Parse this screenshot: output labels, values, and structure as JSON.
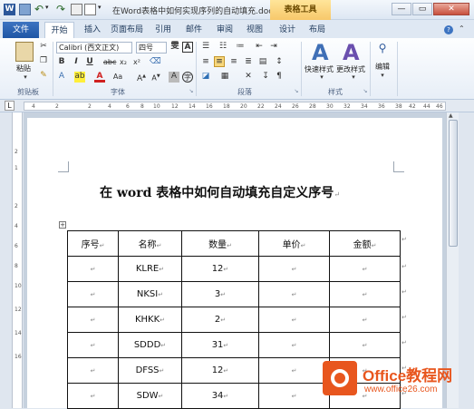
{
  "titlebar": {
    "app_icon": "W",
    "title": "在Word表格中如何实现序列的自动填充.docx M...",
    "table_tools": "表格工具",
    "minimize": "—",
    "maximize": "▭",
    "close": "✕"
  },
  "tabs": [
    "文件",
    "开始",
    "插入",
    "页面布局",
    "引用",
    "邮件",
    "审阅",
    "视图",
    "设计",
    "布局"
  ],
  "ribbon": {
    "paste_label": "粘贴",
    "font_name": "Calibri (西文正文)",
    "font_size": "四号",
    "style_quick": "快速样式",
    "style_change": "更改样式",
    "edit": "编辑",
    "groups": {
      "clipboard": "剪贴板",
      "font": "字体",
      "paragraph": "段落",
      "styles": "样式"
    }
  },
  "ruler": {
    "numbers": [
      "4",
      "2",
      "2",
      "4",
      "6",
      "8",
      "10",
      "12",
      "14",
      "16",
      "18",
      "20",
      "22",
      "24",
      "26",
      "28",
      "30",
      "32",
      "34",
      "36",
      "38",
      "42",
      "44",
      "46"
    ]
  },
  "vruler": {
    "numbers": [
      "2",
      "1",
      "2",
      "4",
      "6",
      "8",
      "10",
      "12",
      "14",
      "16"
    ]
  },
  "document": {
    "heading": "在 word 表格中如何自动填充自定义序号",
    "paragraph_mark": "↵",
    "table": {
      "headers": [
        "序号",
        "名称",
        "数量",
        "单价",
        "金额"
      ],
      "rows": [
        [
          "",
          "KLRE",
          "12",
          "",
          ""
        ],
        [
          "",
          "NKSI",
          "3",
          "",
          ""
        ],
        [
          "",
          "KHKK",
          "2",
          "",
          ""
        ],
        [
          "",
          "SDDD",
          "31",
          "",
          ""
        ],
        [
          "",
          "DFSS",
          "12",
          "",
          ""
        ],
        [
          "",
          "SDW",
          "34",
          "",
          ""
        ]
      ]
    }
  },
  "watermark": {
    "title": "Office教程网",
    "url": "www.office26.com"
  }
}
